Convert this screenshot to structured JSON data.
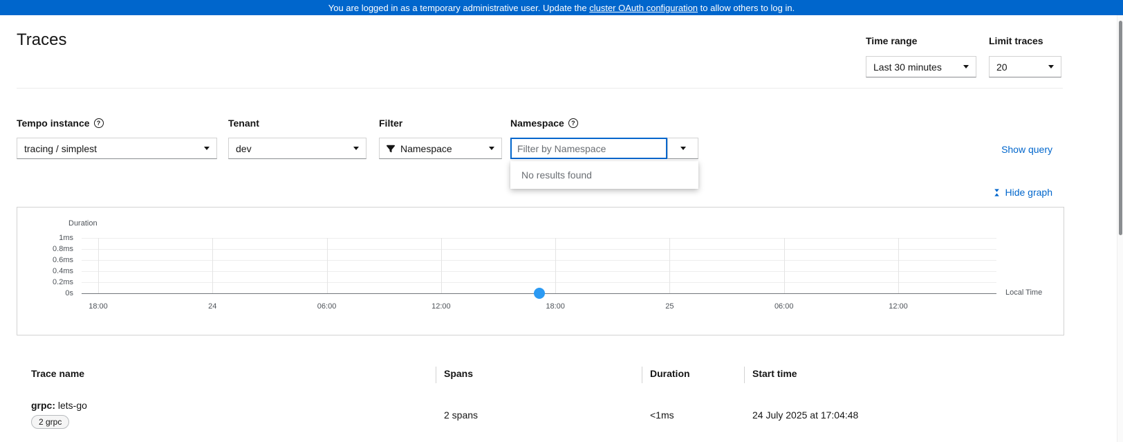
{
  "banner": {
    "prefix": "You are logged in as a temporary administrative user. Update the ",
    "link_text": "cluster OAuth configuration",
    "suffix": " to allow others to log in."
  },
  "page": {
    "title": "Traces"
  },
  "toolbar": {
    "time_range_label": "Time range",
    "time_range_value": "Last 30 minutes",
    "limit_label": "Limit traces",
    "limit_value": "20"
  },
  "filters": {
    "tempo_label": "Tempo instance",
    "tempo_value": "tracing / simplest",
    "tenant_label": "Tenant",
    "tenant_value": "dev",
    "filter_label": "Filter",
    "filter_value": "Namespace",
    "namespace_label": "Namespace",
    "namespace_placeholder": "Filter by Namespace",
    "no_results": "No results found",
    "show_query_label": "Show query"
  },
  "graph": {
    "hide_label": "Hide graph"
  },
  "chart_data": {
    "type": "scatter",
    "title": "",
    "ylabel": "Duration",
    "xlabel": "Local Time",
    "y_ticks": [
      "1ms",
      "0.8ms",
      "0.6ms",
      "0.4ms",
      "0.2ms",
      "0s"
    ],
    "x_ticks": [
      "18:00",
      "24",
      "06:00",
      "12:00",
      "18:00",
      "25",
      "06:00",
      "12:00"
    ],
    "ylim": [
      "0s",
      "1ms"
    ],
    "grid": true,
    "legend": false,
    "point_color": "#2b9af3",
    "points": [
      {
        "label": "grpc: lets-go",
        "time": "24 July 2025 17:04:48",
        "duration": "<1ms",
        "x_frac": 0.551,
        "y_frac": 0
      }
    ]
  },
  "table": {
    "headers": [
      "Trace name",
      "Spans",
      "Duration",
      "Start time"
    ],
    "rows": [
      {
        "name_bold": "grpc:",
        "name_rest": " lets-go",
        "badge": "2 grpc",
        "spans": "2 spans",
        "duration": "<1ms",
        "start_time": "24 July 2025 at 17:04:48"
      }
    ]
  },
  "icons": {
    "help": "?"
  },
  "colors": {
    "banner_bg": "#0066cc",
    "link": "#0066cc",
    "point": "#2b9af3",
    "text": "#151515",
    "muted": "#6a6e73",
    "border": "#d2d2d2"
  }
}
